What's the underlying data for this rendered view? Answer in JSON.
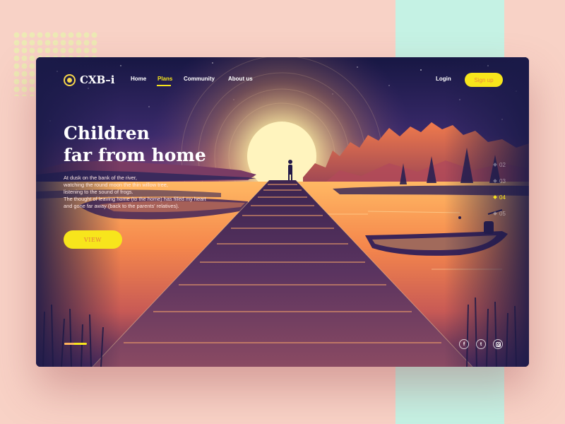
{
  "brand": {
    "name": "CXB–i"
  },
  "nav": {
    "items": [
      {
        "label": "Home",
        "active": false
      },
      {
        "label": "Plans",
        "active": true
      },
      {
        "label": "Community",
        "active": false
      },
      {
        "label": "About us",
        "active": false
      }
    ],
    "login_label": "Login",
    "signup_label": "Sign up"
  },
  "hero": {
    "title_lines": [
      "Children",
      "far from home"
    ],
    "paragraph_lines": [
      "At dusk on the bank of the river,",
      "watching the round moon the thin willow tree,",
      "listening to the sound of frogs.",
      "The thought of leaving home (to the home) has filled my heart",
      "and gone far away (back to the parents' relatives)."
    ],
    "button_label": "VIEW"
  },
  "pager": {
    "items": [
      "02",
      "03",
      "04",
      "05"
    ],
    "active_index": 2
  },
  "social": {
    "items": [
      {
        "icon": "facebook-icon",
        "glyph": "f"
      },
      {
        "icon": "twitter-icon",
        "glyph": "t"
      },
      {
        "icon": "instagram-icon",
        "glyph": ""
      }
    ]
  },
  "colors": {
    "accent": "#f7e51c",
    "page_background": "#f8d2c6",
    "mint_strip": "#c5f2e4",
    "night_sky": "#1d1c49",
    "sunset_orange": "#f28a4a"
  }
}
